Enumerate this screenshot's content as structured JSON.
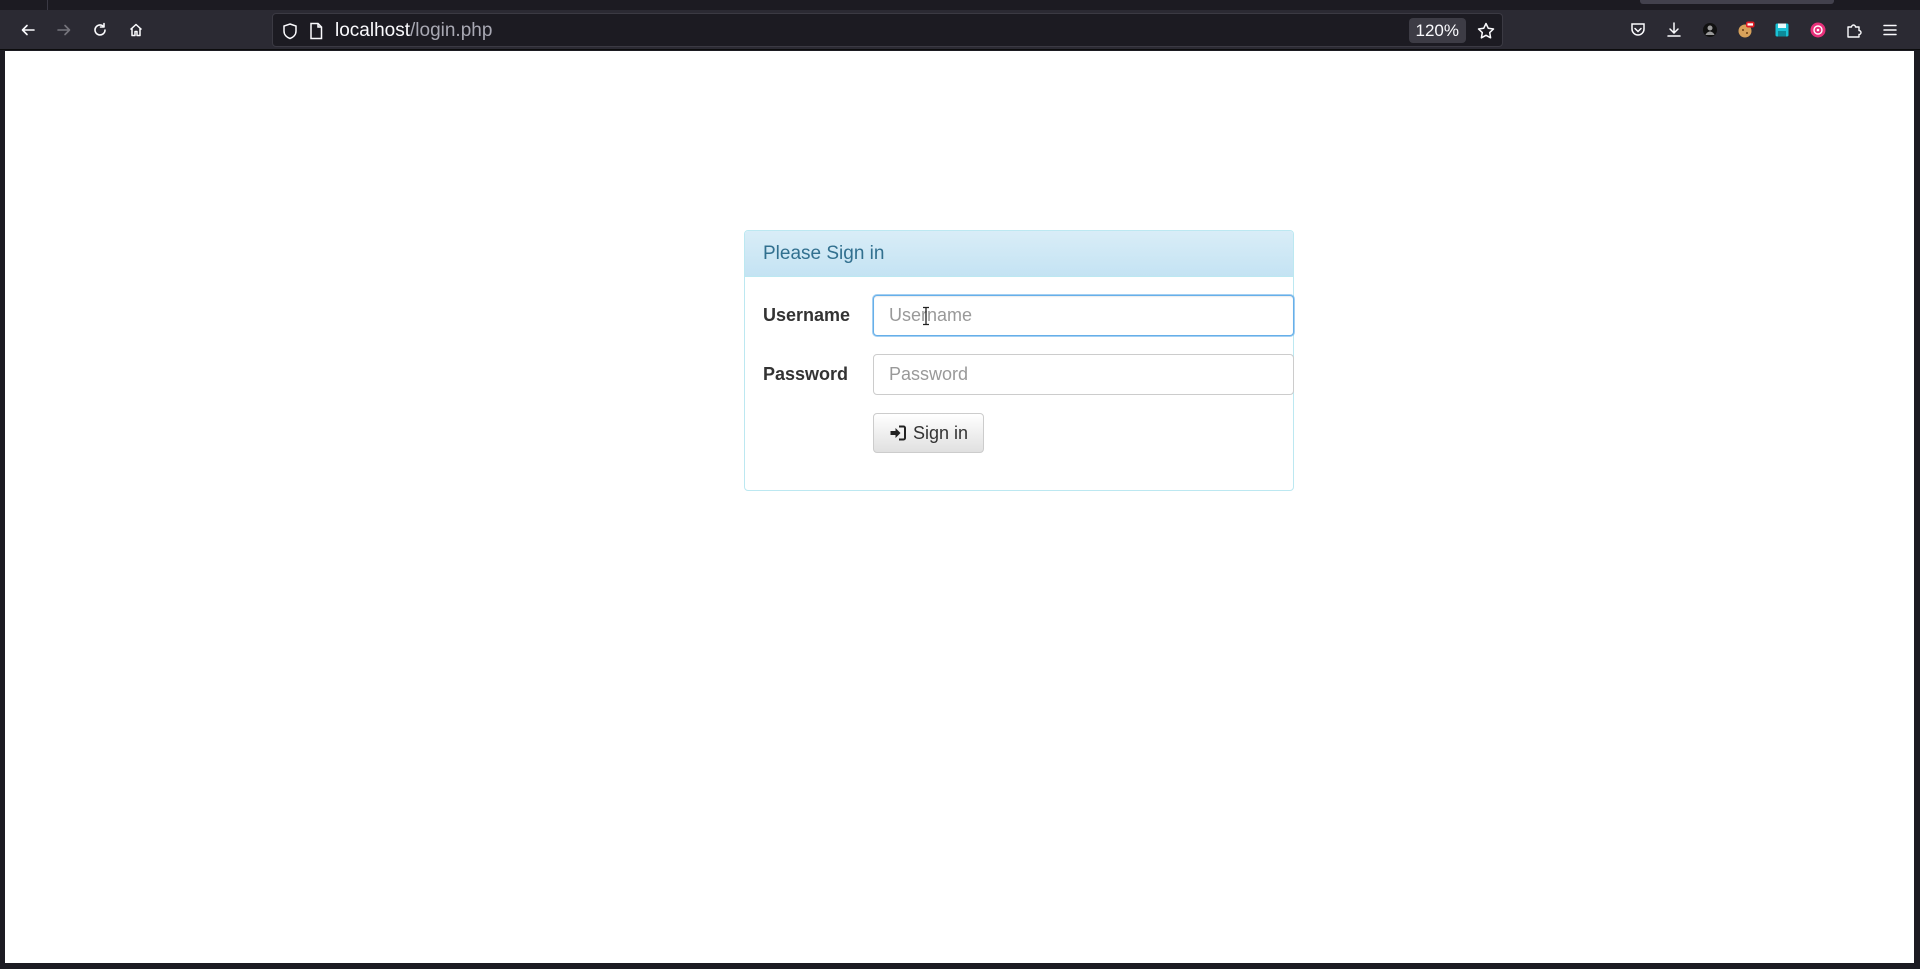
{
  "browser": {
    "url_host": "localhost",
    "url_path": "/login.php",
    "zoom": "120%"
  },
  "login": {
    "title": "Please Sign in",
    "username_label": "Username",
    "username_placeholder": "Username",
    "password_label": "Password",
    "password_placeholder": "Password",
    "signin_label": "Sign in"
  },
  "colors": {
    "chrome_bg": "#2b2a33",
    "panel_border": "#bce8f1",
    "panel_title": "#31708f",
    "heading_bg": "#d9edf7"
  },
  "icons": [
    "back-icon",
    "forward-icon",
    "reload-icon",
    "home-icon",
    "shield-icon",
    "page-icon",
    "bookmark-star-icon",
    "pocket-icon",
    "download-icon",
    "extension-avatar-icon",
    "extension-cookie-icon",
    "extension-save-icon",
    "extension-red-icon",
    "extensions-puzzle-icon",
    "menu-icon",
    "sign-in-icon"
  ]
}
